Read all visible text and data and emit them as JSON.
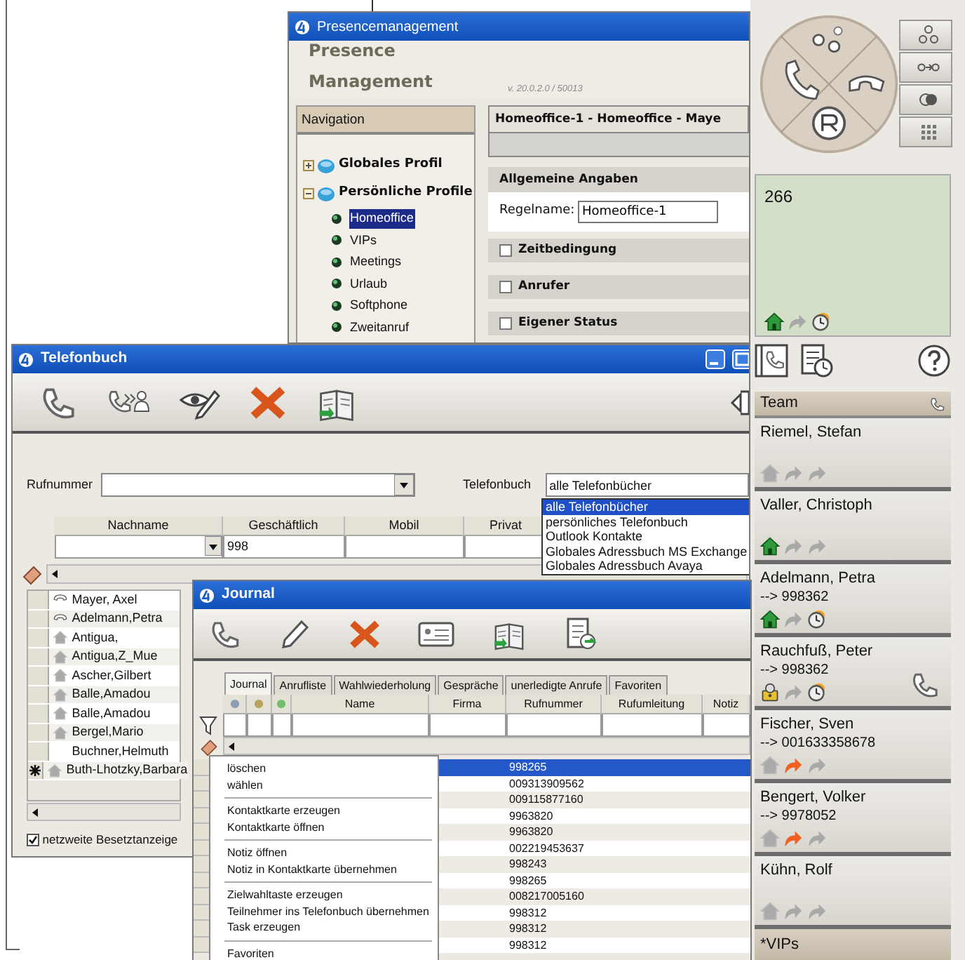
{
  "presence": {
    "title": "Presencemanagement",
    "heading": "Presence Management",
    "version": "v. 20.0.2.0 / 50013",
    "navigation": "Navigation",
    "tree": [
      {
        "label": "Globales Profil",
        "expanded": false
      },
      {
        "label": "Persönliche Profile",
        "expanded": true,
        "children": [
          {
            "label": "Homeoffice",
            "selected": true
          },
          {
            "label": "VIPs",
            "selected": false
          },
          {
            "label": "Meetings",
            "selected": false
          },
          {
            "label": "Urlaub",
            "selected": false
          },
          {
            "label": "Softphone",
            "selected": false
          },
          {
            "label": "Zweitanruf",
            "selected": false
          }
        ]
      }
    ],
    "rule_title": "Homeoffice-1 - Homeoffice - Maye",
    "sections": [
      {
        "kind": "header",
        "label": "Allgemeine Angaben"
      },
      {
        "kind": "field",
        "label": "Regelname:",
        "value": "Homeoffice-1"
      },
      {
        "kind": "check",
        "label": "Zeitbedingung",
        "checked": false
      },
      {
        "kind": "check",
        "label": "Anrufer",
        "checked": false
      },
      {
        "kind": "check",
        "label": "Eigener Status",
        "checked": false
      }
    ]
  },
  "phone": {
    "display": "266",
    "display_status": {
      "kind": "present",
      "forwarded": false,
      "timer": true
    },
    "team": "Team",
    "contacts": [
      {
        "name": "Riemel, Stefan",
        "kind": "absent",
        "forwarded": false,
        "timer": false,
        "on_call": false
      },
      {
        "name": "Valler, Christoph",
        "kind": "present",
        "forwarded": false,
        "timer": false,
        "on_call": false
      },
      {
        "name": "Adelmann, Petra",
        "target": "--> 998362",
        "kind": "present",
        "forwarded": false,
        "timer": true,
        "on_call": false
      },
      {
        "name": "Rauchfuß, Peter",
        "target": "--> 998362",
        "kind": "busy",
        "forwarded": false,
        "timer": true,
        "on_call": true
      },
      {
        "name": "Fischer, Sven",
        "target": "--> 001633358678",
        "kind": "absent",
        "forwarded": true,
        "timer": false,
        "on_call": false
      },
      {
        "name": "Bengert, Volker",
        "target": "--> 9978052",
        "kind": "absent",
        "forwarded": true,
        "timer": false,
        "on_call": false
      },
      {
        "name": "Kühn, Rolf",
        "kind": "absent",
        "forwarded": false,
        "timer": false,
        "on_call": false
      }
    ],
    "group": "*VIPs"
  },
  "phonebook": {
    "title": "Telefonbuch",
    "number_label": "Rufnummer",
    "book_label": "Telefonbuch",
    "book_value": "alle Telefonbücher",
    "book_options": [
      {
        "label": "alle Telefonbücher",
        "selected": true
      },
      {
        "label": "persönliches Telefonbuch",
        "selected": false
      },
      {
        "label": "Outlook Kontakte",
        "selected": false
      },
      {
        "label": "Globales Adressbuch MS Exchange",
        "selected": false
      },
      {
        "label": "Globales Adressbuch Avaya",
        "selected": false
      }
    ],
    "columns": [
      "Nachname",
      "Geschäftlich",
      "Mobil",
      "Privat"
    ],
    "filter": {
      "Geschäftlich": "998"
    },
    "entries": [
      {
        "name": "Mayer, Axel",
        "kind": "phone",
        "new_row": false
      },
      {
        "name": "Adelmann,Petra",
        "kind": "phone",
        "new_row": false
      },
      {
        "name": "Antigua,",
        "kind": "home",
        "new_row": false
      },
      {
        "name": "Antigua,Z_Mue",
        "kind": "home",
        "new_row": false
      },
      {
        "name": "Ascher,Gilbert",
        "kind": "home",
        "new_row": false
      },
      {
        "name": "Balle,Amadou",
        "kind": "home",
        "new_row": false
      },
      {
        "name": "Balle,Amadou",
        "kind": "home",
        "new_row": false
      },
      {
        "name": "Bergel,Mario",
        "kind": "home",
        "new_row": false
      },
      {
        "name": "Buchner,Helmuth",
        "kind": "none",
        "new_row": false
      },
      {
        "name": "Buth-Lhotzky,Barbara",
        "kind": "home",
        "new_row": true
      }
    ],
    "network_busy": {
      "label": "netzweite Besetztanzeige",
      "checked": true
    }
  },
  "journal": {
    "title": "Journal",
    "tabs": [
      {
        "label": "Journal",
        "selected": true
      },
      {
        "label": "Anrufliste",
        "selected": false
      },
      {
        "label": "Wahlwiederholung",
        "selected": false
      },
      {
        "label": "Gespräche",
        "selected": false
      },
      {
        "label": "unerledigte Anrufe",
        "selected": false
      },
      {
        "label": "Favoriten",
        "selected": false
      }
    ],
    "status_columns": [
      {
        "color": "#8c9db4"
      },
      {
        "color": "#b8a25c"
      },
      {
        "color": "#6fbf6a"
      }
    ],
    "columns": [
      "Name",
      "Firma",
      "Rufnummer",
      "Rufumleitung",
      "Notiz"
    ],
    "rows": [
      {
        "number": "998265",
        "selected": true
      },
      {
        "number": "009313909562",
        "selected": false
      },
      {
        "number": "009115877160",
        "selected": false
      },
      {
        "number": "9963820",
        "selected": false
      },
      {
        "number": "9963820",
        "selected": false
      },
      {
        "number": "002219453637",
        "selected": false
      },
      {
        "number": "998243",
        "selected": false
      },
      {
        "number": "998265",
        "selected": false
      },
      {
        "number": "008217005160",
        "selected": false
      },
      {
        "number": "998312",
        "selected": false
      },
      {
        "number": "998312",
        "selected": false
      },
      {
        "number": "998312",
        "selected": false
      }
    ],
    "context_menu": [
      [
        "löschen",
        "wählen"
      ],
      [
        "Kontaktkarte erzeugen",
        "Kontaktkarte öffnen"
      ],
      [
        "Notiz öffnen",
        "Notiz in Kontaktkarte übernehmen"
      ],
      [
        "Zielwahltaste erzeugen",
        "Teilnehmer ins Telefonbuch übernehmen",
        "Task erzeugen"
      ],
      [
        "Favoriten"
      ]
    ]
  }
}
